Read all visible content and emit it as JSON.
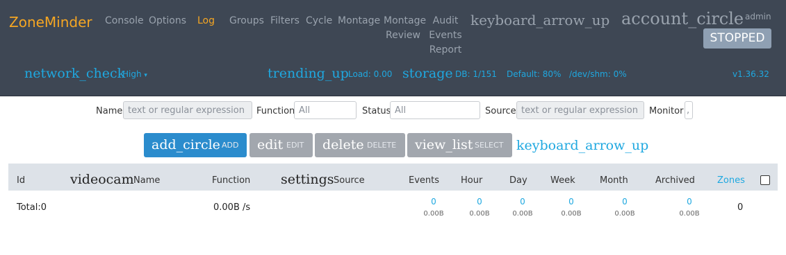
{
  "header": {
    "brand": "ZoneMinder",
    "nav": {
      "console": "Console",
      "options": "Options",
      "log": "Log",
      "groups": "Groups",
      "filters": "Filters",
      "cycle": "Cycle",
      "montage": "Montage",
      "montage_review_1": "Montage",
      "montage_review_2": "Review",
      "audit_1": "Audit",
      "audit_2": "Events",
      "audit_3": "Report"
    },
    "collapse_icon": "keyboard_arrow_up",
    "account_icon": "account_circle",
    "user": "admin",
    "status": "STOPPED"
  },
  "statusbar": {
    "network_icon": "network_check",
    "bandwidth": "High",
    "load_icon": "trending_up",
    "load": "Load: 0.00",
    "storage_icon": "storage",
    "db": "DB: 1/151",
    "default": "Default: 80%",
    "shm": "/dev/shm: 0%",
    "version": "v1.36.32"
  },
  "filters": {
    "name_label": "Name",
    "name_placeholder": "text or regular expression",
    "function_label": "Function",
    "function_value": "All",
    "status_label": "Status",
    "status_value": "All",
    "source_label": "Source",
    "source_placeholder": "text or regular expression",
    "monitor_label": "Monitor",
    "monitor_value": ","
  },
  "toolbar": {
    "add_icon": "add_circle",
    "add_label": "ADD",
    "edit_icon": "edit",
    "edit_label": "EDIT",
    "delete_icon": "delete",
    "delete_label": "DELETE",
    "select_icon": "view_list",
    "select_label": "SELECT",
    "collapse_icon": "keyboard_arrow_up"
  },
  "table": {
    "columns": {
      "id": "Id",
      "name_icon": "videocam",
      "name": "Name",
      "function": "Function",
      "source_icon": "settings",
      "source": "Source",
      "events": "Events",
      "hour": "Hour",
      "day": "Day",
      "week": "Week",
      "month": "Month",
      "archived": "Archived",
      "zones": "Zones"
    },
    "total": {
      "label": "Total:0",
      "function": "0.00B /s",
      "events": "0",
      "events_size": "0.00B",
      "hour": "0",
      "hour_size": "0.00B",
      "day": "0",
      "day_size": "0.00B",
      "week": "0",
      "week_size": "0.00B",
      "month": "0",
      "month_size": "0.00B",
      "archived": "0",
      "archived_size": "0.00B",
      "zones": "0"
    }
  },
  "colors": {
    "header_bg": "#3e4754",
    "brand": "#f5a623",
    "accent": "#1fa8e0",
    "add_button": "#2b8ccd",
    "disabled_button": "#a2a7ae",
    "status_badge": "#8fa0b3"
  }
}
